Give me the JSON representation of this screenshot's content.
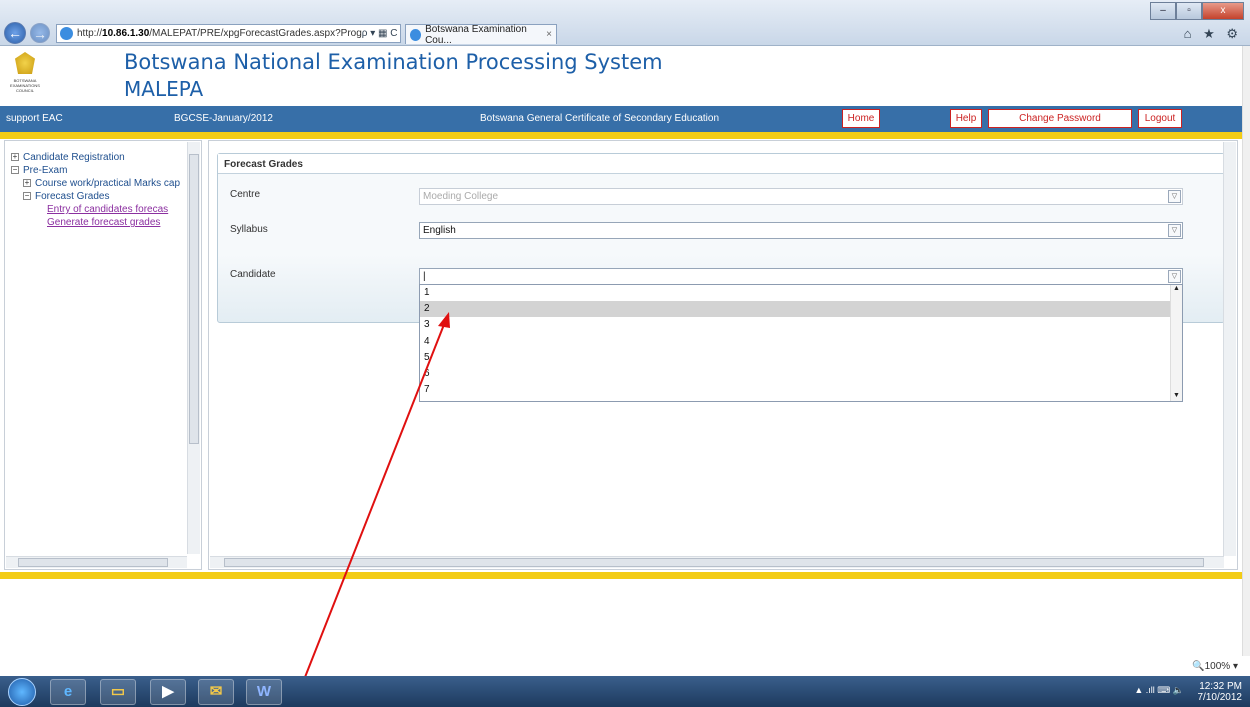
{
  "browser": {
    "url_prefix": "http://",
    "url_host": "10.86.1.30",
    "url_path": "/MALEPAT/PRE/xpgForecastGrades.aspx?Prog",
    "address_tools": "ρ ▾ ▦ C ✕",
    "tab_title": "Botswana Examination Cou...",
    "tab_close": "×",
    "win_min": "–",
    "win_max": "▫",
    "win_close": "x",
    "back": "←",
    "forward": "→",
    "chrome_icons": "⌂ ★ ⚙"
  },
  "header": {
    "logo_text": "BOTSWANA EXAMINATIONS COUNCIL",
    "title_line1": "Botswana National Examination Processing System",
    "title_line2": "MALEPA"
  },
  "topbar": {
    "user": "support EAC",
    "session": "BGCSE-January/2012",
    "programme": "Botswana General Certificate of Secondary Education",
    "home": "Home",
    "help": "Help",
    "change_password": "Change Password",
    "logout": "Logout"
  },
  "tree": {
    "exp_minus": "−",
    "exp_plus": "+",
    "candidate_registration": "Candidate Registration",
    "pre_exam": "Pre-Exam",
    "course_work": "Course work/practical Marks cap",
    "forecast_grades": "Forecast Grades",
    "entry_link": "Entry of candidates forecas",
    "generate_link": "Generate forecast grades"
  },
  "form": {
    "title": "Forecast Grades",
    "centre_label": "Centre",
    "centre_value": "Moeding College",
    "syllabus_label": "Syllabus",
    "syllabus_value": "English",
    "candidate_label": "Candidate",
    "candidate_value": "|",
    "dropdown_arrow": "▽"
  },
  "dropdown": {
    "options": [
      "1",
      "2",
      "3",
      "4",
      "5",
      "6",
      "7"
    ],
    "selected_index": 1,
    "scroll_up": "▲",
    "scroll_down": "▼"
  },
  "status": {
    "zoom": "🔍100%  ▾"
  },
  "taskbar": {
    "ie_glyph": "e",
    "folder_glyph": "▭",
    "media_glyph": "▶",
    "outlook_glyph": "✉",
    "word_glyph": "W",
    "tray_icons": "▲  .ıll  ⌨  🔈",
    "time": "12:32 PM",
    "date": "7/10/2012"
  },
  "colors": {
    "header_blue": "#376fa8",
    "title_blue": "#1d5fa8",
    "accent_yellow": "#f3cc15",
    "link_purple": "#8b2fa0",
    "button_red": "#cc2222",
    "annotation_arrow": "#e01010"
  }
}
